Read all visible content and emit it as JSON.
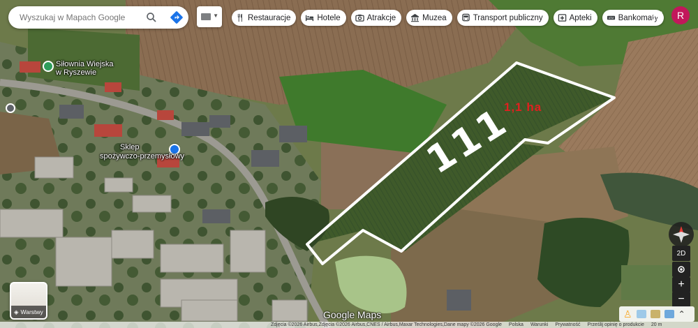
{
  "search": {
    "placeholder": "Wyszukaj w Mapach Google"
  },
  "chips": [
    {
      "label": "Restauracje",
      "icon": "fork-knife-icon"
    },
    {
      "label": "Hotele",
      "icon": "bed-icon"
    },
    {
      "label": "Atrakcje",
      "icon": "camera-icon"
    },
    {
      "label": "Muzea",
      "icon": "museum-icon"
    },
    {
      "label": "Transport publiczny",
      "icon": "bus-icon"
    },
    {
      "label": "Apteki",
      "icon": "pharmacy-icon"
    },
    {
      "label": "Bankomaty",
      "icon": "atm-icon"
    }
  ],
  "account": {
    "initial": "R",
    "color": "#c2185b"
  },
  "pois": [
    {
      "name_line1": "Siłownia Wiejska",
      "name_line2": "w Ryszewie",
      "color": "#2e9d5b"
    },
    {
      "name_line1": "Sklep",
      "name_line2": "spożywczo-przemysłowy",
      "color": "#1a73e8"
    }
  ],
  "annotation": {
    "area": "1,1 ha",
    "parcel_number": "111",
    "area_color": "#e21f1f"
  },
  "layers": {
    "label": "Warstwy"
  },
  "branding": {
    "logo": "Google Maps"
  },
  "footer": {
    "imagery": "Zdjęcia ©2026 Airbus,Zdjęcia ©2026 Airbus,CNES / Airbus,Maxar Technologies,Dane mapy ©2026 Google",
    "links": [
      "Polska",
      "Warunki",
      "Prywatność",
      "Prześlij opinię o produkcie"
    ],
    "scale": "20 m"
  },
  "controls": {
    "mode_2d": "2D",
    "zoom_in": "+",
    "zoom_out": "−",
    "expand": "⌃"
  }
}
